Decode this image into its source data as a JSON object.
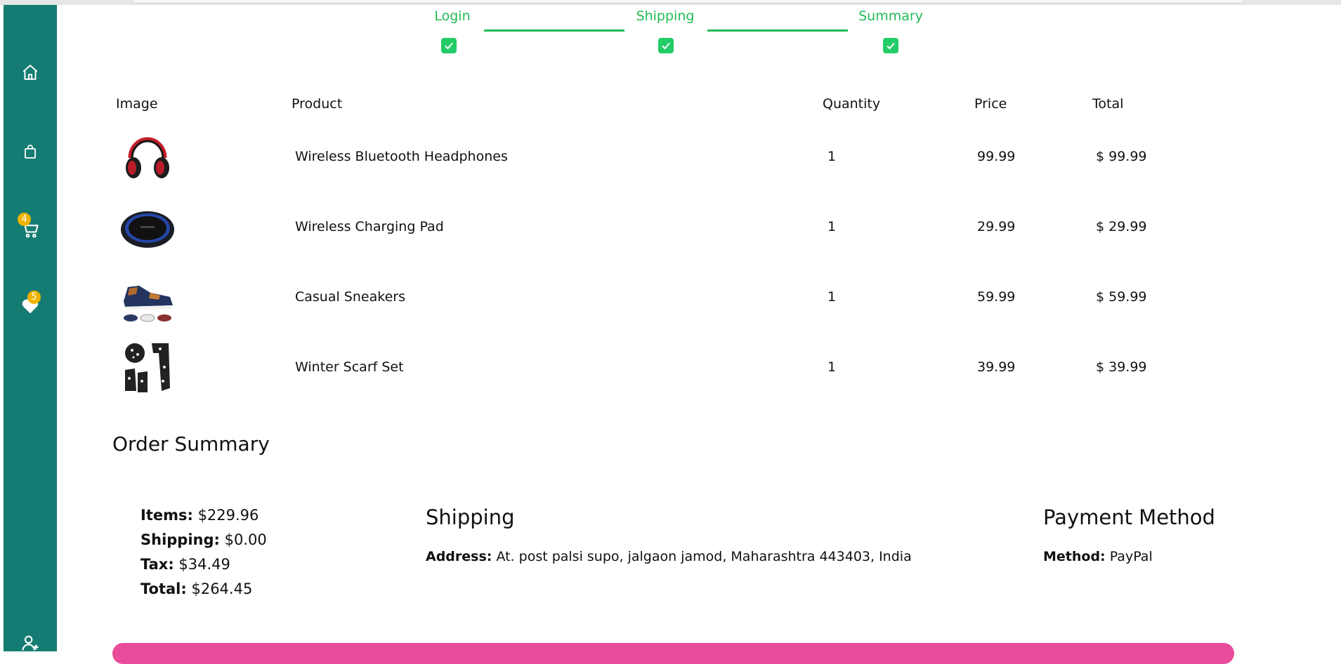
{
  "steps": [
    {
      "label": "Login"
    },
    {
      "label": "Shipping"
    },
    {
      "label": "Summary"
    }
  ],
  "sidebar": {
    "items": [
      {
        "name": "home",
        "icon": "home-icon"
      },
      {
        "name": "shop",
        "icon": "shopping-bag-icon"
      },
      {
        "name": "cart",
        "icon": "cart-icon",
        "badge": "4"
      },
      {
        "name": "favorites",
        "icon": "heart-icon",
        "badge": "5"
      },
      {
        "name": "account",
        "icon": "user-plus-icon"
      }
    ],
    "color": "#147c72",
    "badge_color": "#f0b400"
  },
  "table": {
    "headers": [
      "Image",
      "Product",
      "Quantity",
      "Price",
      "Total"
    ],
    "rows": [
      {
        "product": "Wireless Bluetooth Headphones",
        "quantity": "1",
        "price": "99.99",
        "total": "$ 99.99",
        "image": "headphones"
      },
      {
        "product": "Wireless Charging Pad",
        "quantity": "1",
        "price": "29.99",
        "total": "$ 29.99",
        "image": "charging-pad"
      },
      {
        "product": "Casual Sneakers",
        "quantity": "1",
        "price": "59.99",
        "total": "$ 59.99",
        "image": "sneakers"
      },
      {
        "product": "Winter Scarf Set",
        "quantity": "1",
        "price": "39.99",
        "total": "$ 39.99",
        "image": "scarf-set"
      }
    ]
  },
  "order_summary": {
    "title": "Order Summary",
    "items_label": "Items:",
    "items_value": "$229.96",
    "shipping_label": "Shipping:",
    "shipping_value": "$0.00",
    "tax_label": "Tax:",
    "tax_value": "$34.49",
    "total_label": "Total:",
    "total_value": "$264.45"
  },
  "shipping": {
    "title": "Shipping",
    "address_label": "Address:",
    "address": "At. post palsi supo, jalgaon jamod, Maharashtra 443403, India"
  },
  "payment": {
    "title": "Payment Method",
    "method_label": "Method:",
    "method": "PayPal"
  },
  "colors": {
    "accent_green": "#22bb55",
    "pink_bar": "#e84c9a"
  }
}
